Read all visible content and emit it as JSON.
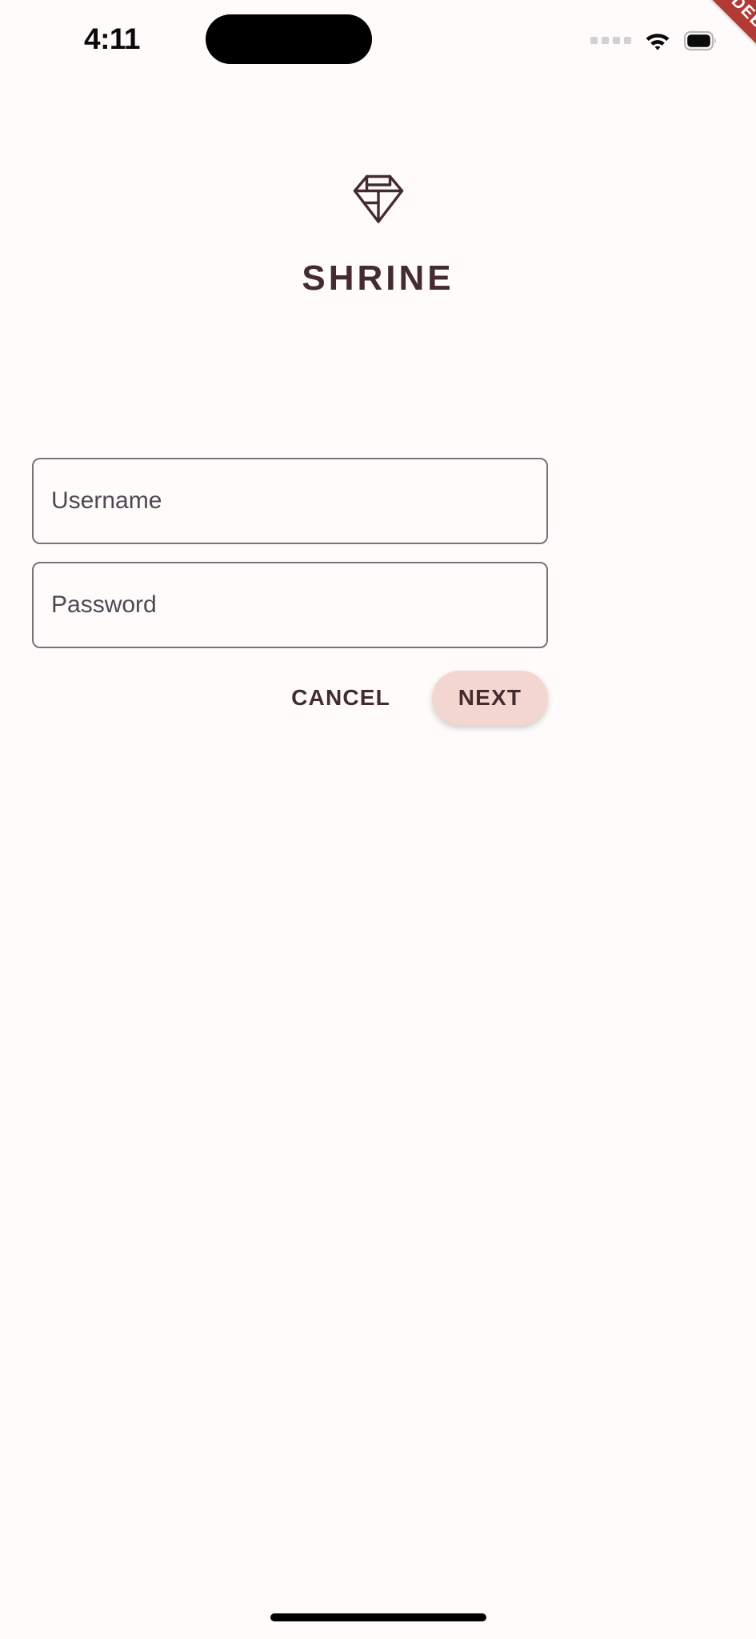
{
  "theme": {
    "background": "#FFFBFB",
    "brand_color": "#442C2E",
    "accent_pink": "#F4D6D1",
    "field_border": "#7C7079",
    "debug_red": "#B23A35"
  },
  "status_bar": {
    "time": "4:11",
    "cellular_icon": "cellular-dots-icon",
    "wifi_icon": "wifi-icon",
    "battery_icon": "battery-icon",
    "dynamic_island": "dynamic-island"
  },
  "debug_banner": {
    "label": "DEBUG"
  },
  "brand": {
    "logo_icon": "diamond-logo-icon",
    "title": "SHRINE"
  },
  "form": {
    "username": {
      "label": "Username",
      "value": "",
      "placeholder": "Username"
    },
    "password": {
      "label": "Password",
      "value": "",
      "placeholder": "Password"
    }
  },
  "actions": {
    "cancel_label": "CANCEL",
    "next_label": "NEXT"
  },
  "system": {
    "home_indicator": "home-indicator"
  }
}
